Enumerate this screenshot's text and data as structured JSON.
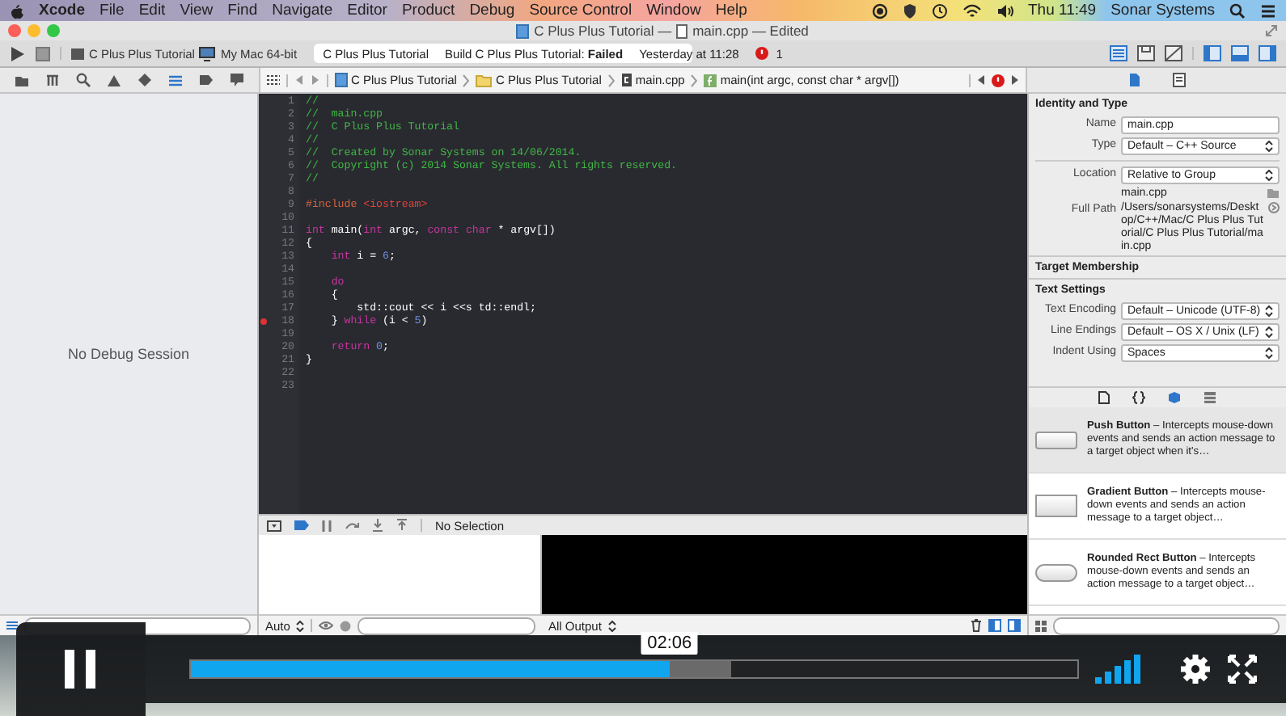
{
  "menu_bar": {
    "items": [
      {
        "label": "Xcode",
        "kind": "app"
      },
      {
        "label": "File",
        "kind": "menu"
      },
      {
        "label": "Edit",
        "kind": "menu"
      },
      {
        "label": "View",
        "kind": "menu"
      },
      {
        "label": "Find",
        "kind": "menu"
      },
      {
        "label": "Navigate",
        "kind": "menu"
      },
      {
        "label": "Editor",
        "kind": "menu"
      },
      {
        "label": "Product",
        "kind": "menu"
      },
      {
        "label": "Debug",
        "kind": "menu"
      },
      {
        "label": "Source Control",
        "kind": "menu"
      },
      {
        "label": "Window",
        "kind": "menu"
      },
      {
        "label": "Help",
        "kind": "menu"
      }
    ],
    "clock": "Thu 11:49",
    "user": "Sonar Systems"
  },
  "window": {
    "title_project": "C Plus Plus Tutorial —",
    "title_file": "main.cpp — Edited"
  },
  "toolbar": {
    "scheme": "C Plus Plus Tutorial",
    "destination": "My Mac 64-bit",
    "status": {
      "project": "C Plus Plus Tutorial",
      "build": "Build C Plus Plus Tutorial: **Failed**",
      "time": "Yesterday at 11:28",
      "error_count": "1"
    }
  },
  "jump_bar": {
    "items": [
      {
        "label": "C Plus Plus Tutorial",
        "kind": "project"
      },
      {
        "label": "C Plus Plus Tutorial",
        "kind": "folder"
      },
      {
        "label": "main.cpp",
        "kind": "file"
      },
      {
        "label": "main(int argc, const char * argv[])",
        "kind": "function"
      }
    ]
  },
  "navigator": {
    "message": "No Debug Session"
  },
  "editor": {
    "lines": [
      {
        "number": "1",
        "error": false,
        "tokens": [
          {
            "text": "//",
            "kind": "comment"
          }
        ]
      },
      {
        "number": "2",
        "error": false,
        "tokens": [
          {
            "text": "//  main.cpp",
            "kind": "comment"
          }
        ]
      },
      {
        "number": "3",
        "error": false,
        "tokens": [
          {
            "text": "//  C Plus Plus Tutorial",
            "kind": "comment"
          }
        ]
      },
      {
        "number": "4",
        "error": false,
        "tokens": [
          {
            "text": "//",
            "kind": "comment"
          }
        ]
      },
      {
        "number": "5",
        "error": false,
        "tokens": [
          {
            "text": "//  Created by Sonar Systems on 14/06/2014.",
            "kind": "comment"
          }
        ]
      },
      {
        "number": "6",
        "error": false,
        "tokens": [
          {
            "text": "//  Copyright (c) 2014 Sonar Systems. All rights reserved.",
            "kind": "comment"
          }
        ]
      },
      {
        "number": "7",
        "error": false,
        "tokens": [
          {
            "text": "//",
            "kind": "comment"
          }
        ]
      },
      {
        "number": "8",
        "error": false
      },
      {
        "number": "9",
        "error": false,
        "tokens": [
          {
            "text": "#include ",
            "kind": "directive"
          },
          {
            "text": "<iostream>",
            "kind": "header"
          }
        ]
      },
      {
        "number": "10",
        "error": false
      },
      {
        "number": "11",
        "error": false,
        "tokens": [
          {
            "text": "int",
            "kind": "keyword"
          },
          {
            "text": " main(",
            "kind": "plain"
          },
          {
            "text": "int",
            "kind": "keyword"
          },
          {
            "text": " argc, ",
            "kind": "plain"
          },
          {
            "text": "const char",
            "kind": "keyword"
          },
          {
            "text": " * argv[])",
            "kind": "plain"
          }
        ]
      },
      {
        "number": "12",
        "error": false,
        "tokens": [
          {
            "text": "{",
            "kind": "plain"
          }
        ]
      },
      {
        "number": "13",
        "error": false,
        "tokens": [
          {
            "text": "    int",
            "kind": "keyword"
          },
          {
            "text": " i = ",
            "kind": "plain"
          },
          {
            "text": "6",
            "kind": "number"
          },
          {
            "text": ";",
            "kind": "plain"
          }
        ]
      },
      {
        "number": "14",
        "error": false
      },
      {
        "number": "15",
        "error": false,
        "tokens": [
          {
            "text": "    do",
            "kind": "keyword"
          }
        ]
      },
      {
        "number": "16",
        "error": false,
        "tokens": [
          {
            "text": "    {",
            "kind": "plain"
          }
        ]
      },
      {
        "number": "17",
        "error": false,
        "tokens": [
          {
            "text": "        std::cout << i <<s td::endl;",
            "kind": "plain"
          }
        ]
      },
      {
        "number": "18",
        "error": true,
        "tokens": [
          {
            "text": "    } ",
            "kind": "plain"
          },
          {
            "text": "while",
            "kind": "keyword"
          },
          {
            "text": " (i < ",
            "kind": "plain"
          },
          {
            "text": "5",
            "kind": "number"
          },
          {
            "text": ")",
            "kind": "plain"
          }
        ]
      },
      {
        "number": "19",
        "error": false
      },
      {
        "number": "20",
        "error": false,
        "tokens": [
          {
            "text": "    return",
            "kind": "keyword"
          },
          {
            "text": " 0",
            "kind": "number"
          },
          {
            "text": ";",
            "kind": "plain"
          }
        ]
      },
      {
        "number": "21",
        "error": false,
        "tokens": [
          {
            "text": "}",
            "kind": "plain"
          }
        ]
      },
      {
        "number": "22",
        "error": false
      },
      {
        "number": "23",
        "error": false
      }
    ]
  },
  "debug_bar": {
    "selection": "No Selection"
  },
  "variables": {
    "scope": "Auto"
  },
  "console": {
    "filter": "All Output"
  },
  "inspector": {
    "identity_title": "Identity and Type",
    "identity_rows": [
      {
        "label": "Name",
        "value": "main.cpp",
        "kind": "input"
      },
      {
        "label": "Type",
        "value": "Default – C++ Source",
        "kind": "select"
      }
    ],
    "location": {
      "label": "Location",
      "value": "Relative to Group"
    },
    "file": "main.cpp",
    "full_path": {
      "label": "Full Path",
      "value": "/Users/sonarsystems/Desktop/C++/Mac/C Plus Plus Tutorial/C Plus Plus Tutorial/main.cpp"
    },
    "target_membership": "Target Membership",
    "text_settings_title": "Text Settings",
    "text_settings": [
      {
        "label": "Text Encoding",
        "value": "Default – Unicode (UTF-8)"
      },
      {
        "label": "Line Endings",
        "value": "Default – OS X / Unix (LF)"
      },
      {
        "label": "Indent Using",
        "value": "Spaces"
      }
    ]
  },
  "library": {
    "items": [
      {
        "text": "**Push Button** – Intercepts mouse-down events and sends an action message to a target object when it's…",
        "kind": "push",
        "selected": true
      },
      {
        "text": "**Gradient Button** – Intercepts mouse-down events and sends an action message to a target object…",
        "kind": "gradient",
        "selected": false
      },
      {
        "text": "**Rounded Rect Button** – Intercepts mouse-down events and sends an action message to a target object…",
        "kind": "rounded",
        "selected": false
      }
    ]
  },
  "player": {
    "time_tooltip": "02:06",
    "progress": {
      "level": 0.54
    },
    "buffer": {
      "level": 0.61
    }
  }
}
